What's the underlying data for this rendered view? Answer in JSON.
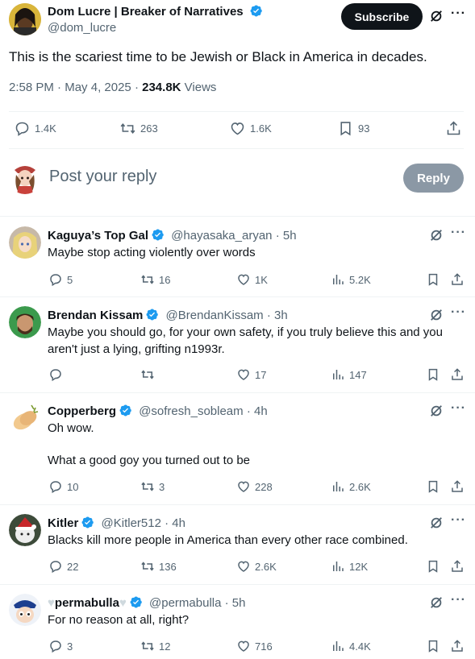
{
  "main_tweet": {
    "author_name": "Dom Lucre | Breaker of Narratives",
    "handle": "@dom_lucre",
    "subscribe_label": "Subscribe",
    "text": "This is the scariest time to be Jewish or Black in America in decades.",
    "time": "2:58 PM",
    "date": "May 4, 2025",
    "views_count": "234.8K",
    "views_label": "Views",
    "replies": "1.4K",
    "reposts": "263",
    "likes": "1.6K",
    "bookmarks": "93"
  },
  "composer": {
    "placeholder": "Post your reply",
    "reply_button": "Reply"
  },
  "replies": [
    {
      "name": "Kaguya’s Top Gal",
      "handle": "@hayasaka_aryan",
      "time": "5h",
      "lines": [
        "Maybe stop acting violently over words"
      ],
      "replies": "5",
      "reposts": "16",
      "likes": "1K",
      "views": "5.2K"
    },
    {
      "name": "Brendan Kissam",
      "handle": "@BrendanKissam",
      "time": "3h",
      "lines": [
        "Maybe you should go, for your own safety, if you truly believe this and you",
        "aren't just a lying, grifting n1993r."
      ],
      "replies": "",
      "reposts": "",
      "likes": "17",
      "views": "147"
    },
    {
      "name": "Copperberg",
      "handle": "@sofresh_sobleam",
      "time": "4h",
      "lines": [
        "Oh wow.",
        "What a good goy you turned out to be"
      ],
      "replies": "10",
      "reposts": "3",
      "likes": "228",
      "views": "2.6K"
    },
    {
      "name": "Kitler",
      "handle": "@Kitler512",
      "time": "4h",
      "lines": [
        "Blacks kill more people in America than every other race combined."
      ],
      "replies": "22",
      "reposts": "136",
      "likes": "2.6K",
      "views": "12K"
    },
    {
      "name": "permabulla",
      "handle": "@permabulla",
      "time": "5h",
      "lines": [
        "For no reason at all, right?"
      ],
      "replies": "3",
      "reposts": "12",
      "likes": "716",
      "views": "4.4K"
    }
  ],
  "colors": {
    "verified": "#1d9bf0",
    "text": "#0f1419",
    "muted": "#536471",
    "reply_button_bg": "#8b98a5"
  }
}
